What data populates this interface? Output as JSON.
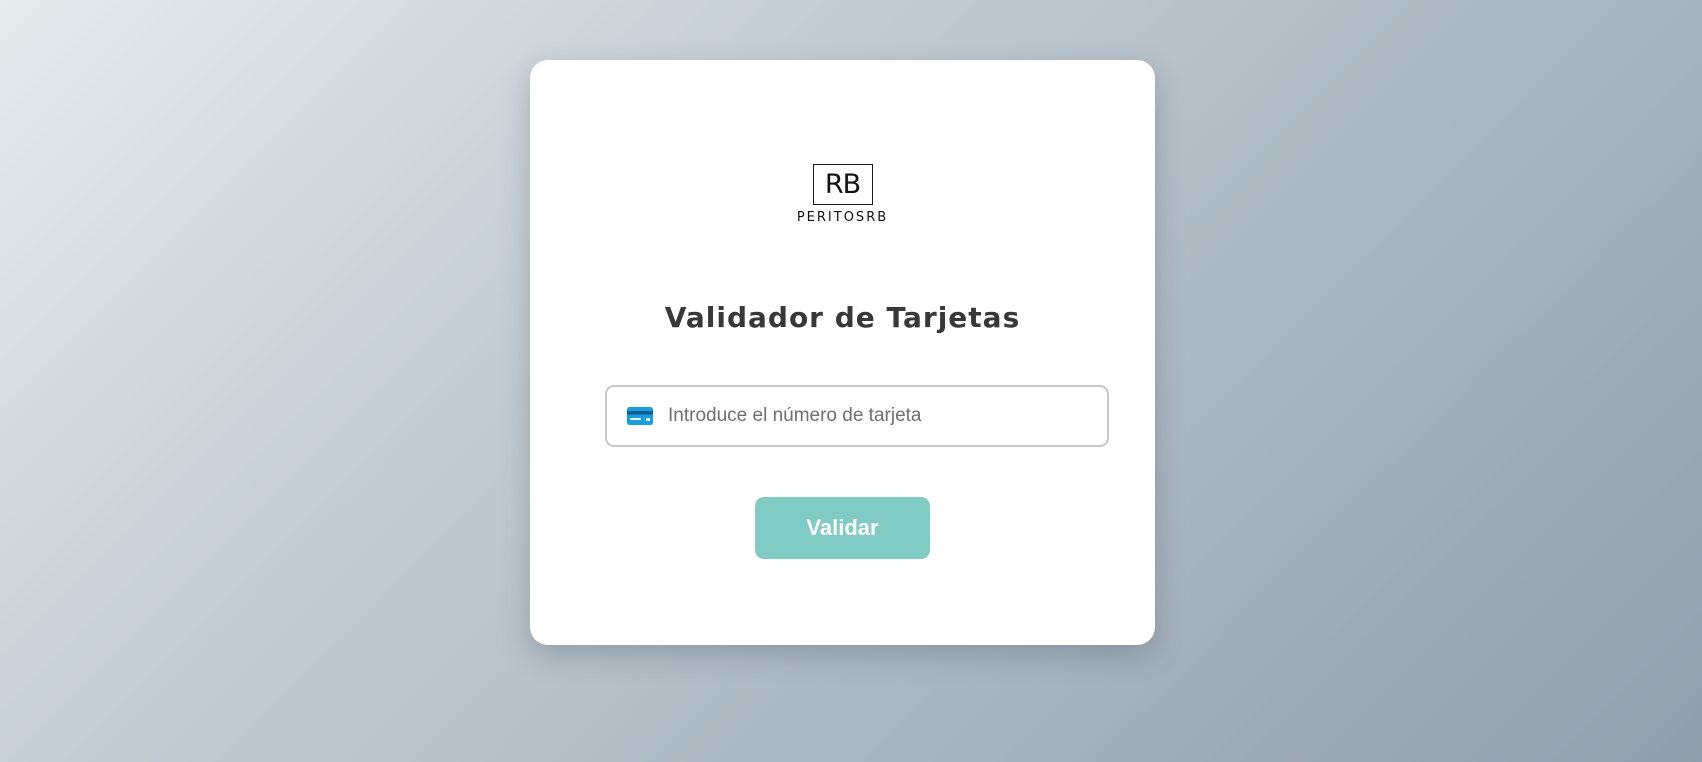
{
  "logo": {
    "mark": "RB",
    "wordmark": "PERITOSRB"
  },
  "form": {
    "title": "Validador de Tarjetas",
    "card_input": {
      "value": "",
      "placeholder": "Introduce el número de tarjeta",
      "icon": "credit-card-icon"
    },
    "validate_label": "Validar"
  },
  "colors": {
    "accent": "#80cbc4",
    "card_icon": "#1b9ee0"
  }
}
